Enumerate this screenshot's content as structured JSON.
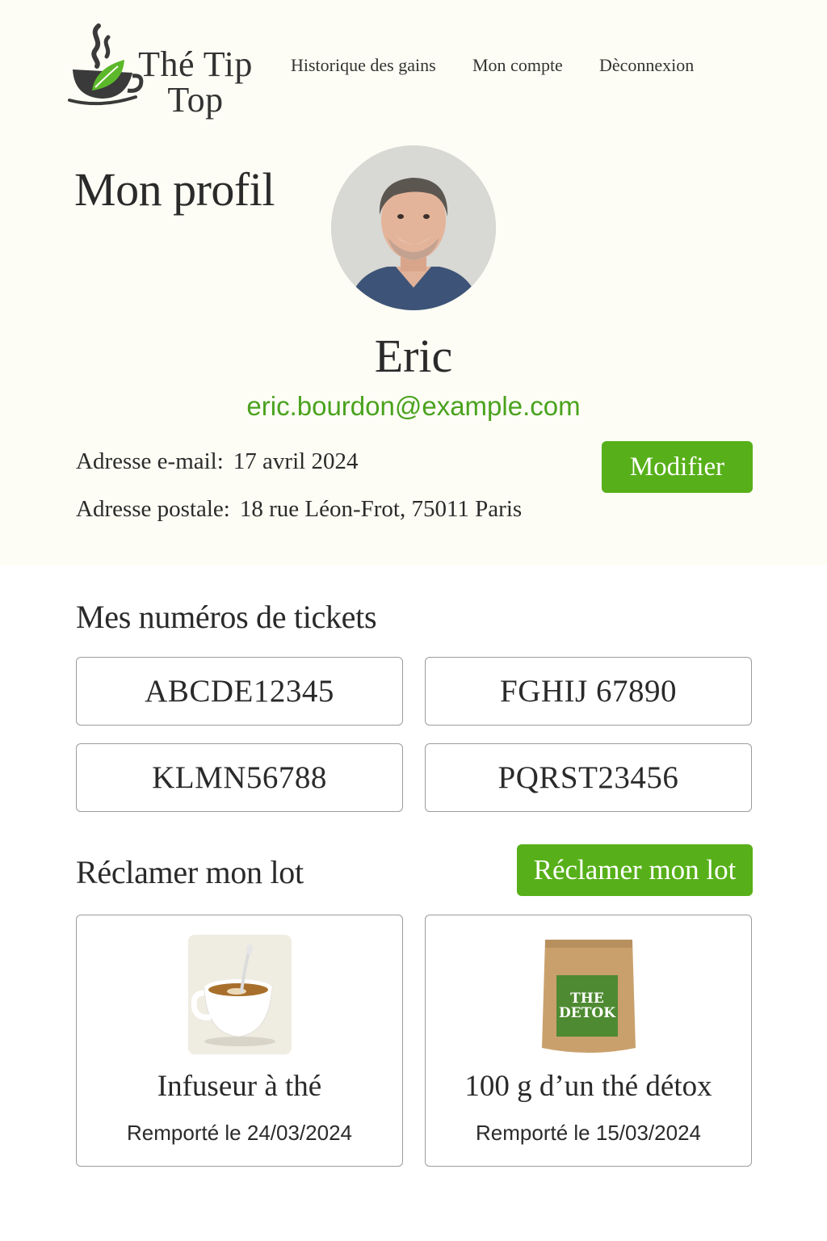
{
  "header": {
    "logo_text_line1": "Thé Tip",
    "logo_text_line2": "Top",
    "nav": [
      {
        "label": "Historique des gains"
      },
      {
        "label": "Mon compte"
      },
      {
        "label": "Dèconnexion"
      }
    ]
  },
  "profile": {
    "title": "Mon profil",
    "name": "Eric",
    "email": "eric.bourdon@example.com",
    "fields": [
      {
        "label": "Adresse e-mail:",
        "value": "17 avril 2024"
      },
      {
        "label": "Adresse postale:",
        "value": "18 rue Léon-Frot, 75011 Paris"
      }
    ],
    "edit_label": "Modifier"
  },
  "tickets": {
    "title": "Mes numéros de tickets",
    "items": [
      "ABCDE12345",
      "FGHIJ 67890",
      "KLMN56788",
      "PQRST23456"
    ]
  },
  "prizes": {
    "title": "Réclamer mon lot",
    "claim_label": "Réclamer mon lot",
    "items": [
      {
        "name": "Infuseur à thé",
        "date": "Remporté le 24/03/2024",
        "icon": "tea-cup-image"
      },
      {
        "name": "100 g d’un thé détox",
        "date": "Remporté le 15/03/2024",
        "icon": "detox-tea-bag-image",
        "bag_label_1": "THE",
        "bag_label_2": "DETOK"
      }
    ]
  },
  "colors": {
    "accent": "#57b019",
    "email": "#4aa21e",
    "background_top": "#fdfdf5"
  }
}
